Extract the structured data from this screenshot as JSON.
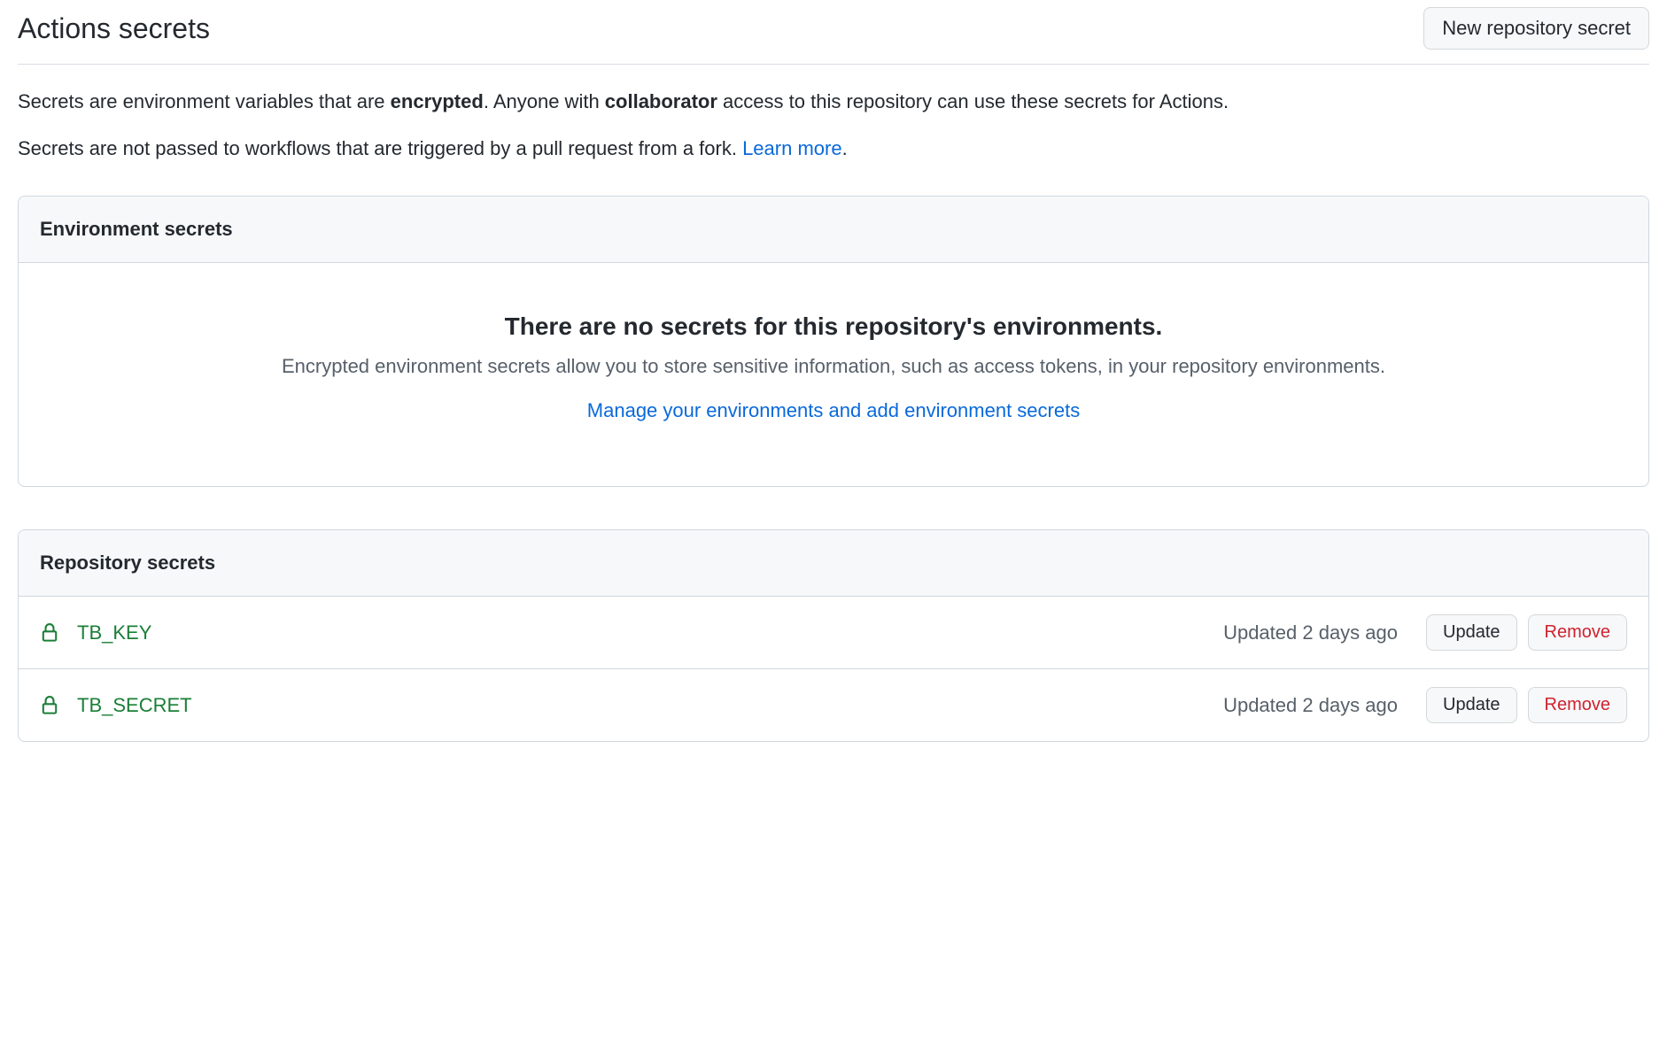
{
  "header": {
    "title": "Actions secrets",
    "new_button": "New repository secret"
  },
  "intro": {
    "p1_a": "Secrets are environment variables that are ",
    "p1_strong1": "encrypted",
    "p1_b": ". Anyone with ",
    "p1_strong2": "collaborator",
    "p1_c": " access to this repository can use these secrets for Actions.",
    "p2_a": "Secrets are not passed to workflows that are triggered by a pull request from a fork. ",
    "p2_link": "Learn more",
    "p2_b": "."
  },
  "env_panel": {
    "heading": "Environment secrets",
    "empty_title": "There are no secrets for this repository's environments.",
    "empty_desc": "Encrypted environment secrets allow you to store sensitive information, such as access tokens, in your repository environments.",
    "manage_link": "Manage your environments and add environment secrets"
  },
  "repo_panel": {
    "heading": "Repository secrets",
    "secrets": [
      {
        "name": "TB_KEY",
        "updated": "Updated 2 days ago",
        "update": "Update",
        "remove": "Remove"
      },
      {
        "name": "TB_SECRET",
        "updated": "Updated 2 days ago",
        "update": "Update",
        "remove": "Remove"
      }
    ]
  }
}
